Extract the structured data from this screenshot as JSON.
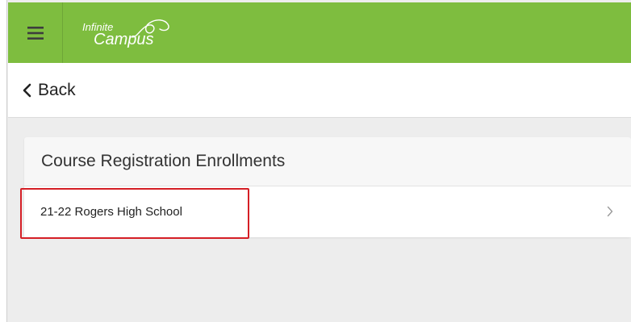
{
  "header": {
    "logo_line1": "Infinite",
    "logo_line2": "Campus",
    "menu_icon": "hamburger-menu-icon",
    "brand_color": "#7ebd3f"
  },
  "nav": {
    "back_label": "Back",
    "back_icon": "chevron-left-icon"
  },
  "card": {
    "title": "Course Registration Enrollments",
    "items": [
      {
        "label": "21-22 Rogers High School",
        "icon": "chevron-right-icon"
      }
    ]
  },
  "annotation": {
    "highlight_color": "#d51f26"
  }
}
